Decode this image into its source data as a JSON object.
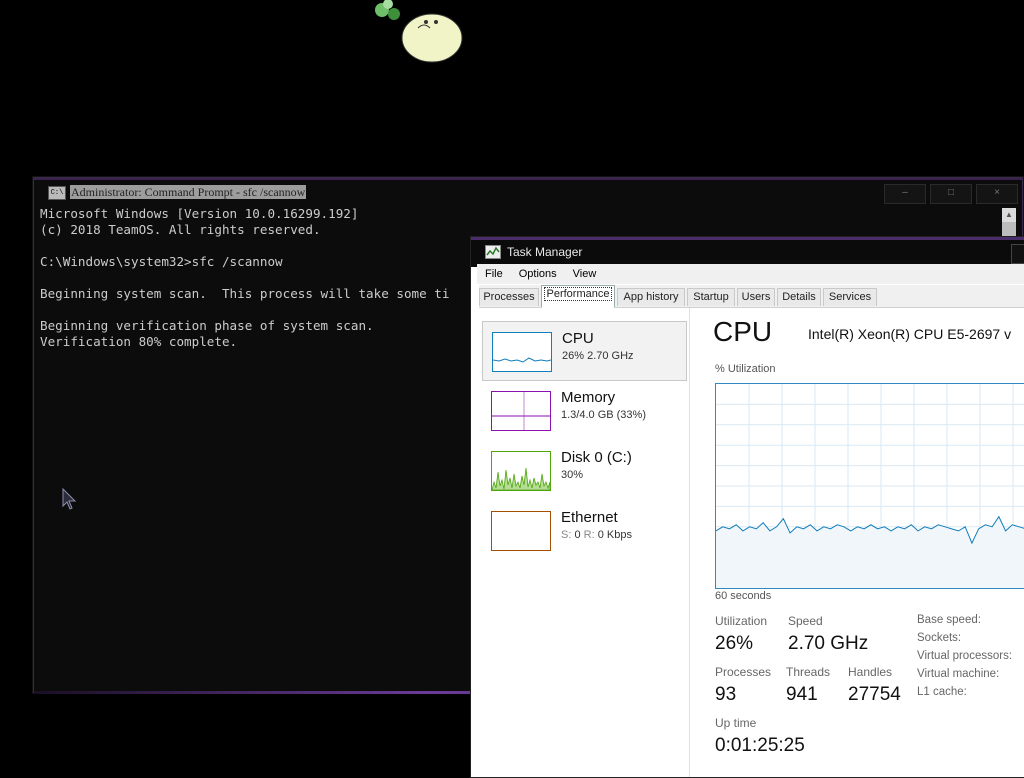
{
  "cmd_window": {
    "title": "Administrator: Command Prompt - sfc  /scannow",
    "icon_label": "C:\\",
    "controls": [
      "–",
      "□",
      "×"
    ],
    "lines": [
      "Microsoft Windows [Version 10.0.16299.192]",
      "(c) 2018 TeamOS. All rights reserved.",
      "",
      "C:\\Windows\\system32>sfc /scannow",
      "",
      "Beginning system scan.  This process will take some ti",
      "",
      "Beginning verification phase of system scan.",
      "Verification 80% complete."
    ],
    "scroll_up": "▲"
  },
  "task_manager": {
    "title": "Task Manager",
    "menu": [
      "File",
      "Options",
      "View"
    ],
    "tabs": [
      "Processes",
      "Performance",
      "App history",
      "Startup",
      "Users",
      "Details",
      "Services"
    ],
    "active_tab": "Performance",
    "resources": [
      {
        "name": "CPU",
        "detail": "26%  2.70 GHz",
        "color": "#117dbb"
      },
      {
        "name": "Memory",
        "detail": "1.3/4.0 GB (33%)",
        "color": "#8b12ae"
      },
      {
        "name": "Disk 0 (C:)",
        "detail": "30%",
        "color": "#4da60c"
      },
      {
        "name": "Ethernet",
        "detail_s_label": "S:",
        "detail_s": "0",
        "detail_r_label": "R:",
        "detail_r": "0 Kbps",
        "color": "#a74f01"
      }
    ],
    "cpu": {
      "heading": "CPU",
      "model": "Intel(R) Xeon(R) CPU E5-2697 v",
      "util_label": "% Utilization",
      "graph_span": "60 seconds",
      "stats": {
        "utilization_label": "Utilization",
        "utilization": "26%",
        "speed_label": "Speed",
        "speed": "2.70 GHz",
        "processes_label": "Processes",
        "processes": "93",
        "threads_label": "Threads",
        "threads": "941",
        "handles_label": "Handles",
        "handles": "27754",
        "uptime_label": "Up time",
        "uptime": "0:01:25:25"
      },
      "specs": [
        "Base speed:",
        "Sockets:",
        "Virtual processors:",
        "Virtual machine:",
        "L1 cache:"
      ]
    }
  },
  "chart_data": {
    "type": "line",
    "title": "",
    "xlabel": "60 seconds",
    "ylabel": "% Utilization",
    "ylim": [
      0,
      100
    ],
    "series": [
      {
        "values": [
          28,
          30,
          29,
          31,
          28,
          30,
          29,
          32,
          28,
          30,
          34,
          27,
          30,
          29,
          31,
          28,
          30,
          29,
          31,
          30,
          28,
          30,
          29,
          31,
          29,
          30,
          28,
          30,
          29,
          31,
          28,
          30,
          29,
          31,
          30,
          29,
          28,
          30,
          22,
          29,
          31,
          30,
          35,
          28,
          31,
          30,
          29,
          32,
          28,
          30
        ]
      }
    ]
  }
}
